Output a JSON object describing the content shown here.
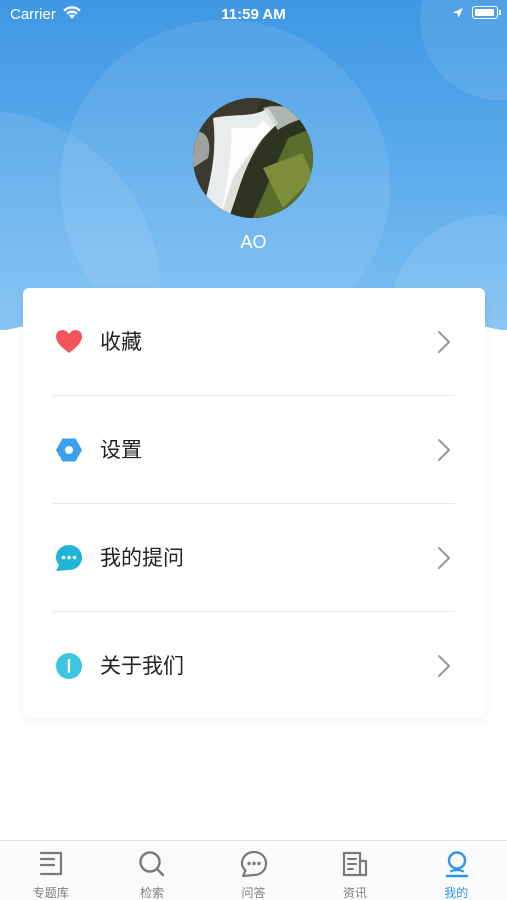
{
  "status_bar": {
    "carrier": "Carrier",
    "time": "11:59 AM"
  },
  "profile": {
    "username": "AO"
  },
  "menu": [
    {
      "label": "收藏",
      "icon": "heart-icon",
      "color": "#f2545b"
    },
    {
      "label": "设置",
      "icon": "settings-hexagon-icon",
      "color": "#3aa0ee"
    },
    {
      "label": "我的提问",
      "icon": "chat-bubble-icon",
      "color": "#1fb5d6"
    },
    {
      "label": "关于我们",
      "icon": "info-icon",
      "color": "#3cc6e0"
    }
  ],
  "tabs": [
    {
      "label": "专题库",
      "icon": "topic-list-icon",
      "active": false
    },
    {
      "label": "检索",
      "icon": "search-icon",
      "active": false
    },
    {
      "label": "问答",
      "icon": "qa-bubble-icon",
      "active": false
    },
    {
      "label": "资讯",
      "icon": "news-icon",
      "active": false
    },
    {
      "label": "我的",
      "icon": "profile-icon",
      "active": true
    }
  ],
  "colors": {
    "accent": "#2c97e8",
    "header_top": "#3f97e2",
    "header_bottom": "#7dc0f3"
  }
}
